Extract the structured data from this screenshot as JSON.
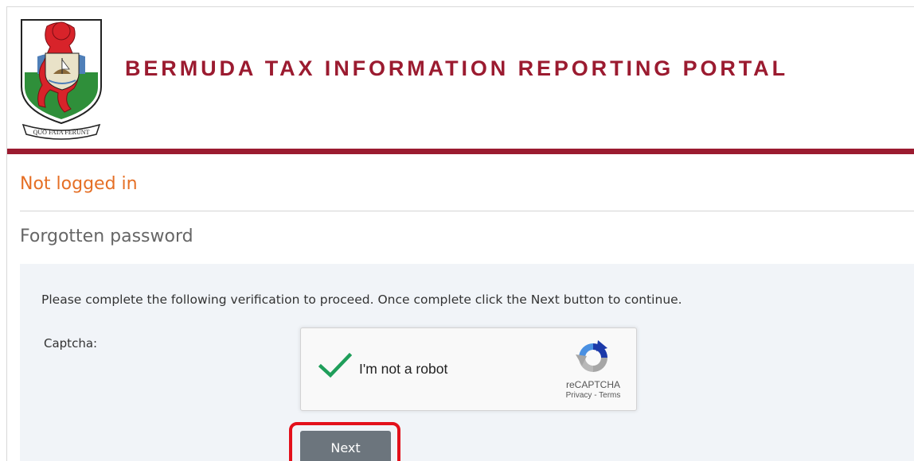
{
  "header": {
    "title": "BERMUDA TAX INFORMATION REPORTING PORTAL",
    "crest_motto": "QUO FATA FERUNT"
  },
  "status": {
    "login_text": "Not logged in"
  },
  "page": {
    "title": "Forgotten password"
  },
  "form": {
    "instructions": "Please complete the following verification to proceed. Once complete click the Next button to continue.",
    "captcha_label": "Captcha:",
    "next_label": "Next"
  },
  "recaptcha": {
    "label": "I'm not a robot",
    "brand": "reCAPTCHA",
    "privacy": "Privacy",
    "separator": " - ",
    "terms": "Terms",
    "checked": true
  },
  "colors": {
    "brand_red": "#9b1b30",
    "status_orange": "#e56f25",
    "panel_bg": "#f1f4f8",
    "button_gray": "#6c757d",
    "check_green": "#1f9e5a",
    "highlight_red": "#e3101b"
  },
  "icons": {
    "crest": "bermuda-coat-of-arms-icon",
    "check": "checkmark-icon",
    "recaptcha": "recaptcha-logo-icon"
  }
}
